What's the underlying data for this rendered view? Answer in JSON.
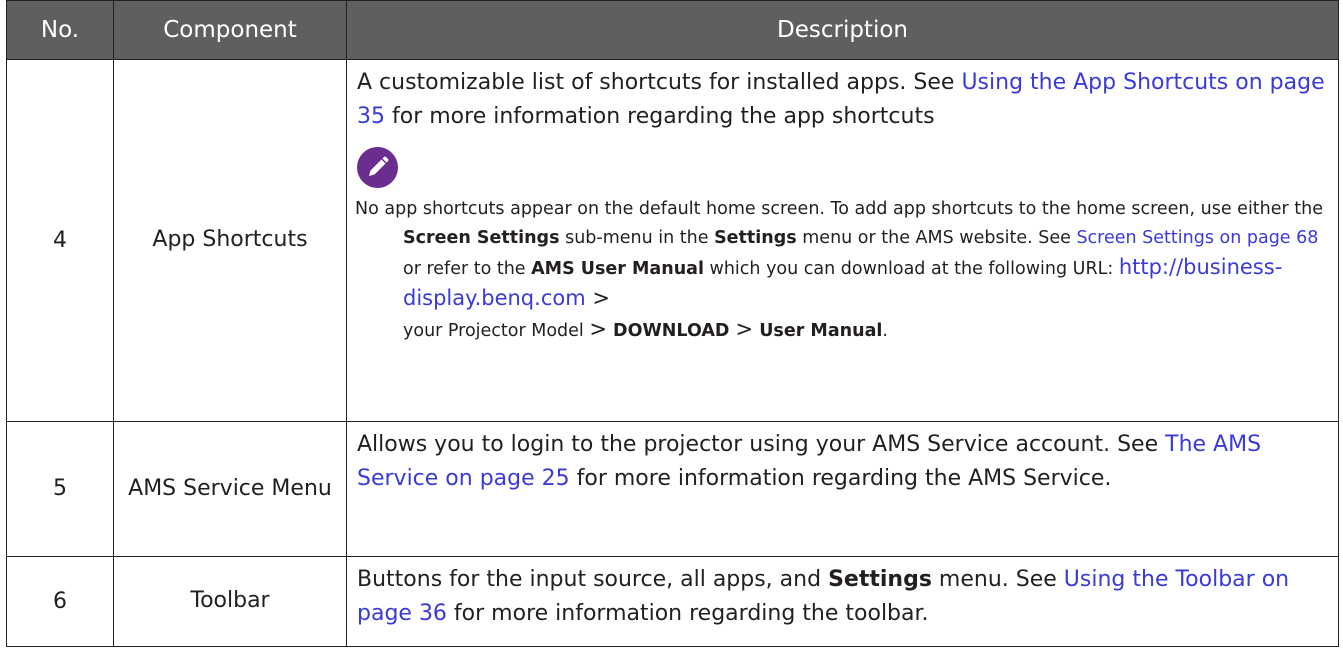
{
  "table": {
    "header": {
      "no": "No.",
      "component": "Component",
      "description": "Description"
    },
    "rows": [
      {
        "no": "4",
        "component": "App Shortcuts",
        "desc_text_1": "A customizable list of shortcuts for installed apps. See ",
        "desc_link_1": "Using the App Shortcuts on page 35",
        "desc_text_2": " for more information regarding the app shortcuts",
        "note": {
          "icon": "pencil-note-icon",
          "t1": "No app shortcuts appear on the default home screen. To add app shortcuts to the home screen, use either the ",
          "b1": "Screen Settings",
          "t2": " sub-menu in the ",
          "b2": "Settings",
          "t3": " menu or the AMS website. See ",
          "link": "Screen Settings on page 68",
          "t4": " or refer to the ",
          "b3": "AMS User Manual",
          "t5": " which you can download at the following URL: ",
          "url": "http://business-display.benq.com",
          "gt1": " > ",
          "t6": "your Projector Model ",
          "gt2": ">",
          "b4": " DOWNLOAD ",
          "gt3": ">",
          "b5": " User Manual",
          "t7": "."
        }
      },
      {
        "no": "5",
        "component": "AMS Service Menu",
        "desc_text_1": "Allows you to login to the projector using your AMS Service account. See ",
        "desc_link_1": "The AMS Service on page 25",
        "desc_text_2": " for more information regarding the AMS Service."
      },
      {
        "no": "6",
        "component": "Toolbar",
        "desc_text_1": "Buttons for the input source, all apps, and ",
        "desc_bold_1": "Settings",
        "desc_text_2": " menu. See ",
        "desc_link_1": "Using the Toolbar on page 36",
        "desc_text_3": " for more information regarding the toolbar."
      }
    ]
  },
  "colors": {
    "header_bg": "#5f5f5f",
    "link": "#3a3ad8",
    "note_icon": "#6b2d8f"
  }
}
